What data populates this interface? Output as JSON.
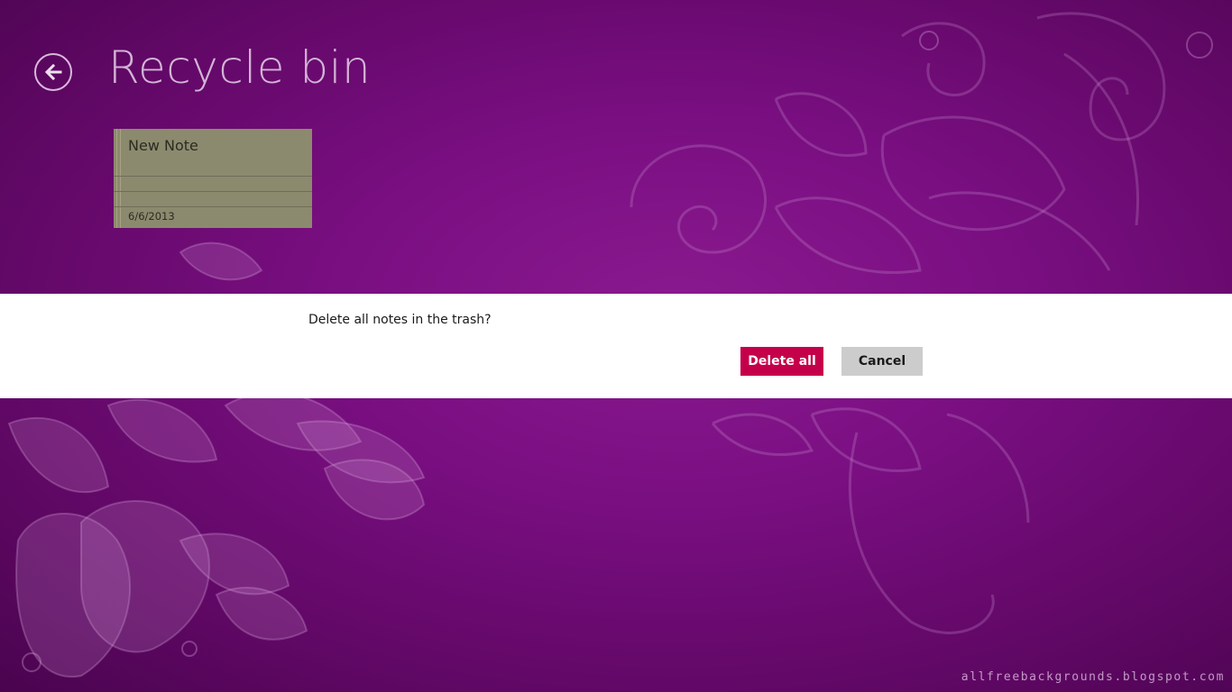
{
  "page": {
    "title": "Recycle bin"
  },
  "notes": [
    {
      "title": "New Note",
      "date": "6/6/2013"
    }
  ],
  "dialog": {
    "message": "Delete all notes in the trash?",
    "confirm_label": "Delete all",
    "cancel_label": "Cancel"
  },
  "background": {
    "watermark": "allfreebackgrounds.blogspot.com"
  },
  "icons": {
    "back": "back-arrow-icon"
  },
  "colors": {
    "background": "#7a0f82",
    "title_text": "#d2b4d5",
    "note_tile": "#8c8a6e",
    "dialog_background": "#ffffff",
    "confirm_button": "#c5004a",
    "cancel_button": "#cccccc"
  }
}
